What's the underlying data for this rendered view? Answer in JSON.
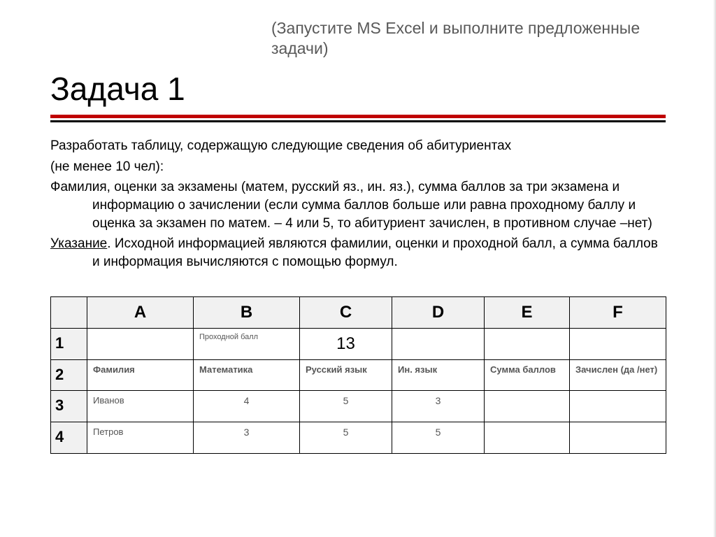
{
  "launch_note": "(Запустите MS Excel и выполните предложенные задачи)",
  "title": "Задача 1",
  "body": {
    "p1": "Разработать таблицу, содержащую следующие сведения об абитуриентах",
    "p2": "(не менее 10 чел):",
    "p3": "Фамилия, оценки за экзамены (матем, русский яз., ин. яз.), сумма баллов за три экзамена и информацию о зачислении (если сумма баллов больше или равна проходному баллу и оценка за экзамен по матем. – 4 или 5, то абитуриент зачислен, в противном случае –нет)",
    "hint_label": "Указание",
    "hint_rest": ". Исходной информацией являются фамилии, оценки и проходной балл, а сумма баллов и информация вычисляются с помощью формул."
  },
  "table": {
    "col_letters": [
      "A",
      "B",
      "C",
      "D",
      "E",
      "F"
    ],
    "row_nums": [
      "1",
      "2",
      "3",
      "4"
    ],
    "row1": {
      "b": "Проходной балл",
      "c": "13"
    },
    "row2": {
      "a": "Фамилия",
      "b": "Математика",
      "c": "Русский язык",
      "d": "Ин. язык",
      "e": "Сумма баллов",
      "f": "Зачислен (да /нет)"
    },
    "row3": {
      "a": "Иванов",
      "b": "4",
      "c": "5",
      "d": "3"
    },
    "row4": {
      "a": "Петров",
      "b": "3",
      "c": "5",
      "d": "5"
    }
  },
  "chart_data": {
    "type": "table",
    "columns": [
      "A",
      "B",
      "C",
      "D",
      "E",
      "F"
    ],
    "rows": [
      {
        "num": 1,
        "A": "",
        "B": "Проходной балл",
        "C": 13,
        "D": "",
        "E": "",
        "F": ""
      },
      {
        "num": 2,
        "A": "Фамилия",
        "B": "Математика",
        "C": "Русский язык",
        "D": "Ин. язык",
        "E": "Сумма баллов",
        "F": "Зачислен (да /нет)"
      },
      {
        "num": 3,
        "A": "Иванов",
        "B": 4,
        "C": 5,
        "D": 3,
        "E": "",
        "F": ""
      },
      {
        "num": 4,
        "A": "Петров",
        "B": 3,
        "C": 5,
        "D": 5,
        "E": "",
        "F": ""
      }
    ]
  }
}
